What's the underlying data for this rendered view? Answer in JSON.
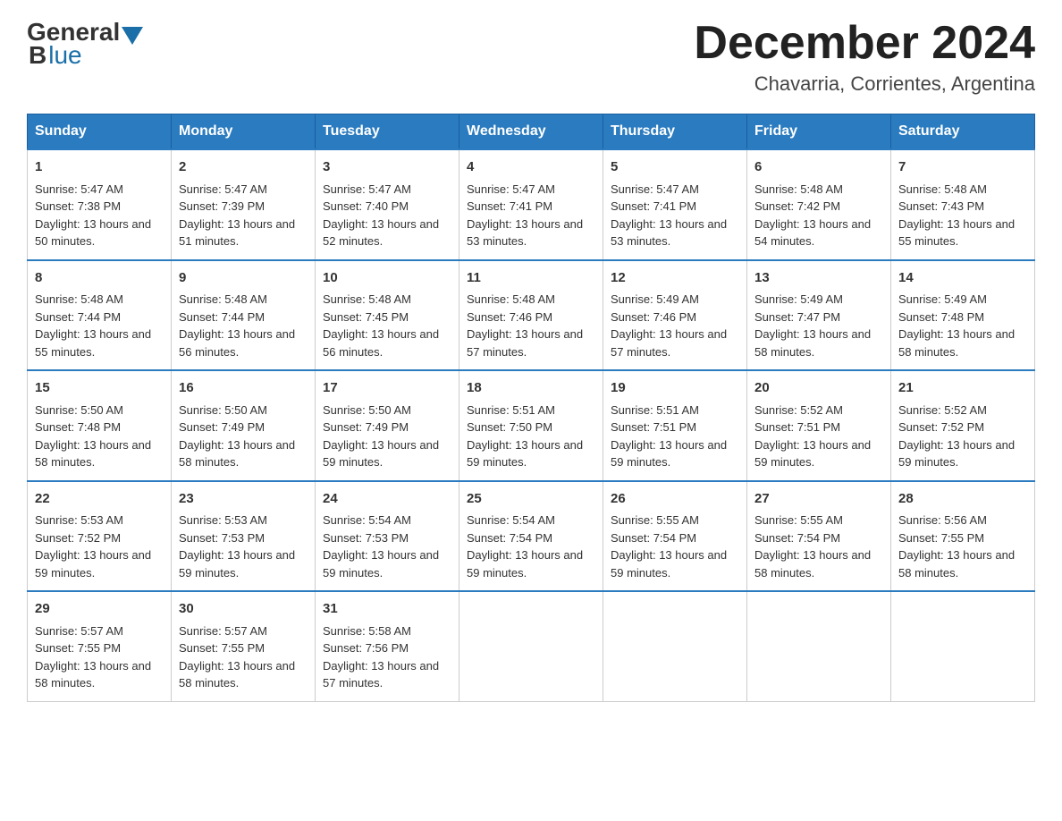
{
  "logo": {
    "general": "General",
    "blue": "Blue"
  },
  "header": {
    "month_year": "December 2024",
    "location": "Chavarria, Corrientes, Argentina"
  },
  "days_of_week": [
    "Sunday",
    "Monday",
    "Tuesday",
    "Wednesday",
    "Thursday",
    "Friday",
    "Saturday"
  ],
  "weeks": [
    [
      {
        "day": "1",
        "sunrise": "5:47 AM",
        "sunset": "7:38 PM",
        "daylight": "13 hours and 50 minutes."
      },
      {
        "day": "2",
        "sunrise": "5:47 AM",
        "sunset": "7:39 PM",
        "daylight": "13 hours and 51 minutes."
      },
      {
        "day": "3",
        "sunrise": "5:47 AM",
        "sunset": "7:40 PM",
        "daylight": "13 hours and 52 minutes."
      },
      {
        "day": "4",
        "sunrise": "5:47 AM",
        "sunset": "7:41 PM",
        "daylight": "13 hours and 53 minutes."
      },
      {
        "day": "5",
        "sunrise": "5:47 AM",
        "sunset": "7:41 PM",
        "daylight": "13 hours and 53 minutes."
      },
      {
        "day": "6",
        "sunrise": "5:48 AM",
        "sunset": "7:42 PM",
        "daylight": "13 hours and 54 minutes."
      },
      {
        "day": "7",
        "sunrise": "5:48 AM",
        "sunset": "7:43 PM",
        "daylight": "13 hours and 55 minutes."
      }
    ],
    [
      {
        "day": "8",
        "sunrise": "5:48 AM",
        "sunset": "7:44 PM",
        "daylight": "13 hours and 55 minutes."
      },
      {
        "day": "9",
        "sunrise": "5:48 AM",
        "sunset": "7:44 PM",
        "daylight": "13 hours and 56 minutes."
      },
      {
        "day": "10",
        "sunrise": "5:48 AM",
        "sunset": "7:45 PM",
        "daylight": "13 hours and 56 minutes."
      },
      {
        "day": "11",
        "sunrise": "5:48 AM",
        "sunset": "7:46 PM",
        "daylight": "13 hours and 57 minutes."
      },
      {
        "day": "12",
        "sunrise": "5:49 AM",
        "sunset": "7:46 PM",
        "daylight": "13 hours and 57 minutes."
      },
      {
        "day": "13",
        "sunrise": "5:49 AM",
        "sunset": "7:47 PM",
        "daylight": "13 hours and 58 minutes."
      },
      {
        "day": "14",
        "sunrise": "5:49 AM",
        "sunset": "7:48 PM",
        "daylight": "13 hours and 58 minutes."
      }
    ],
    [
      {
        "day": "15",
        "sunrise": "5:50 AM",
        "sunset": "7:48 PM",
        "daylight": "13 hours and 58 minutes."
      },
      {
        "day": "16",
        "sunrise": "5:50 AM",
        "sunset": "7:49 PM",
        "daylight": "13 hours and 58 minutes."
      },
      {
        "day": "17",
        "sunrise": "5:50 AM",
        "sunset": "7:49 PM",
        "daylight": "13 hours and 59 minutes."
      },
      {
        "day": "18",
        "sunrise": "5:51 AM",
        "sunset": "7:50 PM",
        "daylight": "13 hours and 59 minutes."
      },
      {
        "day": "19",
        "sunrise": "5:51 AM",
        "sunset": "7:51 PM",
        "daylight": "13 hours and 59 minutes."
      },
      {
        "day": "20",
        "sunrise": "5:52 AM",
        "sunset": "7:51 PM",
        "daylight": "13 hours and 59 minutes."
      },
      {
        "day": "21",
        "sunrise": "5:52 AM",
        "sunset": "7:52 PM",
        "daylight": "13 hours and 59 minutes."
      }
    ],
    [
      {
        "day": "22",
        "sunrise": "5:53 AM",
        "sunset": "7:52 PM",
        "daylight": "13 hours and 59 minutes."
      },
      {
        "day": "23",
        "sunrise": "5:53 AM",
        "sunset": "7:53 PM",
        "daylight": "13 hours and 59 minutes."
      },
      {
        "day": "24",
        "sunrise": "5:54 AM",
        "sunset": "7:53 PM",
        "daylight": "13 hours and 59 minutes."
      },
      {
        "day": "25",
        "sunrise": "5:54 AM",
        "sunset": "7:54 PM",
        "daylight": "13 hours and 59 minutes."
      },
      {
        "day": "26",
        "sunrise": "5:55 AM",
        "sunset": "7:54 PM",
        "daylight": "13 hours and 59 minutes."
      },
      {
        "day": "27",
        "sunrise": "5:55 AM",
        "sunset": "7:54 PM",
        "daylight": "13 hours and 58 minutes."
      },
      {
        "day": "28",
        "sunrise": "5:56 AM",
        "sunset": "7:55 PM",
        "daylight": "13 hours and 58 minutes."
      }
    ],
    [
      {
        "day": "29",
        "sunrise": "5:57 AM",
        "sunset": "7:55 PM",
        "daylight": "13 hours and 58 minutes."
      },
      {
        "day": "30",
        "sunrise": "5:57 AM",
        "sunset": "7:55 PM",
        "daylight": "13 hours and 58 minutes."
      },
      {
        "day": "31",
        "sunrise": "5:58 AM",
        "sunset": "7:56 PM",
        "daylight": "13 hours and 57 minutes."
      },
      null,
      null,
      null,
      null
    ]
  ]
}
